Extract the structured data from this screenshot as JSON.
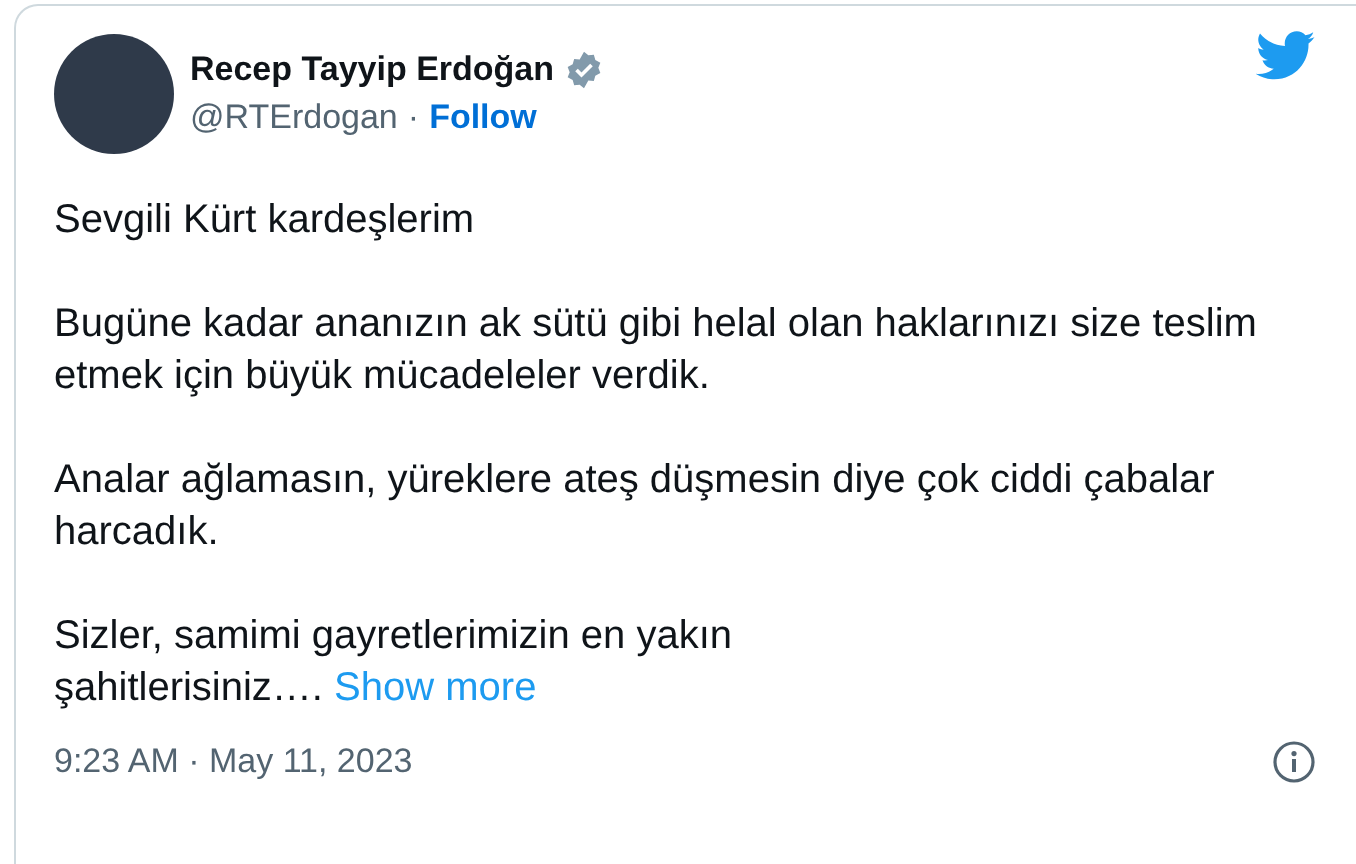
{
  "author": {
    "name": "Recep Tayyip Erdoğan",
    "verified": true,
    "handle": "@RTErdogan",
    "separator": "·",
    "follow": "Follow"
  },
  "paragraphs": [
    "Sevgili Kürt kardeşlerim",
    "Bugüne kadar ananızın ak sütü gibi helal olan haklarınızı size teslim etmek için büyük mücadeleler verdik.",
    "Analar ağlamasın, yüreklere ateş düşmesin diye çok ciddi çabalar harcadık.",
    "Sizler, samimi gayretlerimizin en yakın\nşahitlerisiniz…."
  ],
  "show_more": "Show more",
  "timestamp": "9:23 AM · May 11, 2023"
}
